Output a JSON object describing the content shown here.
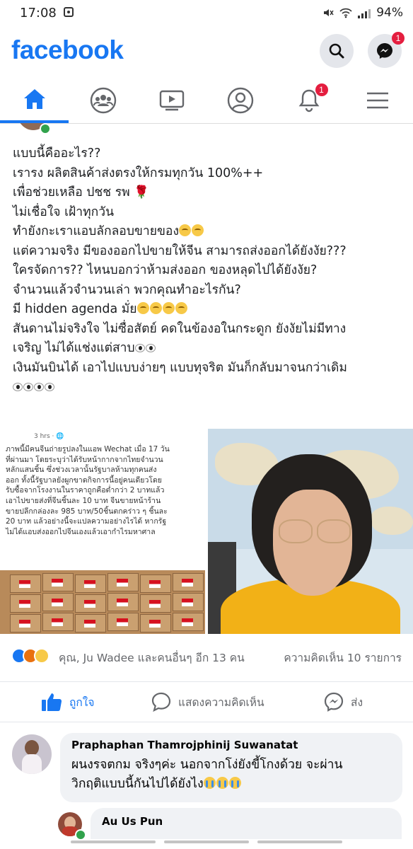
{
  "status_bar": {
    "time": "17:08",
    "battery": "94%"
  },
  "header": {
    "logo": "facebook",
    "search_icon": "search-icon",
    "messenger_icon": "messenger-icon",
    "messenger_badge": "1"
  },
  "tabs": [
    {
      "name": "home",
      "icon": "home-icon",
      "active": true
    },
    {
      "name": "groups",
      "icon": "groups-icon"
    },
    {
      "name": "watch",
      "icon": "video-icon"
    },
    {
      "name": "profile",
      "icon": "profile-icon"
    },
    {
      "name": "notifications",
      "icon": "bell-icon",
      "badge": "1"
    },
    {
      "name": "menu",
      "icon": "menu-icon"
    }
  ],
  "post": {
    "lines": [
      "แบบนี้คืออะไร??",
      "เรารง ผลิตสินค้าส่งตรงให้กรมทุกวัน 100%++",
      "เพื่อช่วยเหลือ ปชช รพ",
      "ไม่เชื่อใจ เฝ้าทุกวัน",
      "ทำยังกะเราแอบลักลอบขายของ",
      "แต่ความจริง มีของออกไปขายให้จีน สามารถส่งออกได้ยังงัย???",
      "ใครจัดการ?? ไหนบอกว่าห้ามส่งออก ของหลุดไปได้ยังงัย?",
      "จำนวนแล้วจำนวนเล่า พวกคุณทำอะไรกัน?",
      "มี hidden agenda มั่ย",
      "สันดานไม่จริงใจ ไม่ซื่อสัตย์ คดในข้องอในกระดูก ยังงัยไม่มีทาง",
      "เจริญ ไม่ได้แช่งแต่สาบ",
      "เงินมันบินได้ เอาไปแบบง่ายๆ แบบทุจริต มันก็กลับมาจนกว่าเดิม"
    ],
    "screenshot": {
      "meta": "3 hrs",
      "lines": [
        "ภาพนี้มีคนจีนถ่ายรูปลงในแอพ Wechat เมื่อ 17 วัน",
        "ที่ผ่านมา โดยระบุว่าได้รับหน้ากากจากไทยจำนวน",
        "หลักแสนชิ้น ซึ่งช่วงเวลานั้นรัฐบาลห้ามทุกคนส่ง",
        "ออก ทั้งนี้รัฐบาลยังผูกขาดกิจการนี้อยู่คนเดียวโดย",
        "รับซื้อจากโรงงานในราคาถูกคือต่ำกว่า 2 บาทแล้ว",
        "เอาไปขายส่งที่จีนชิ้นละ 10 บาท จีนขายหน้าร้าน",
        "ขายปลีกกล่องละ 985 บาท/50ชิ้นตกคร่าว ๆ ชิ้นละ",
        "20 บาท แล้วอย่างนี้จะแปลความอย่างไรได้ หากรัฐ",
        "ไม่ได้แอบส่งออกไปจีนเองแล้วเอากำไรมหาศาล"
      ]
    }
  },
  "reactions": {
    "names": "คุณ, Ju Wadee และคนอื่นๆ อีก 13 คน",
    "comments": "ความคิดเห็น 10 รายการ"
  },
  "actions": {
    "like": "ถูกใจ",
    "comment": "แสดงความคิดเห็น",
    "share": "ส่ง"
  },
  "comments": [
    {
      "name": "Praphaphan Thamrojphinij Suwanatat",
      "lines": [
        "ผนงรจตกม จริงๆค่ะ นอกจากโง่ยังขี้โกงด้วย จะผ่าน",
        "วิกฤติแบบนี้กันไปได้ยังไง"
      ]
    },
    {
      "name": "Au Us Pun"
    }
  ],
  "colors": {
    "brand": "#1877f2",
    "like": "#1877f2",
    "badge": "#e41e3f"
  }
}
